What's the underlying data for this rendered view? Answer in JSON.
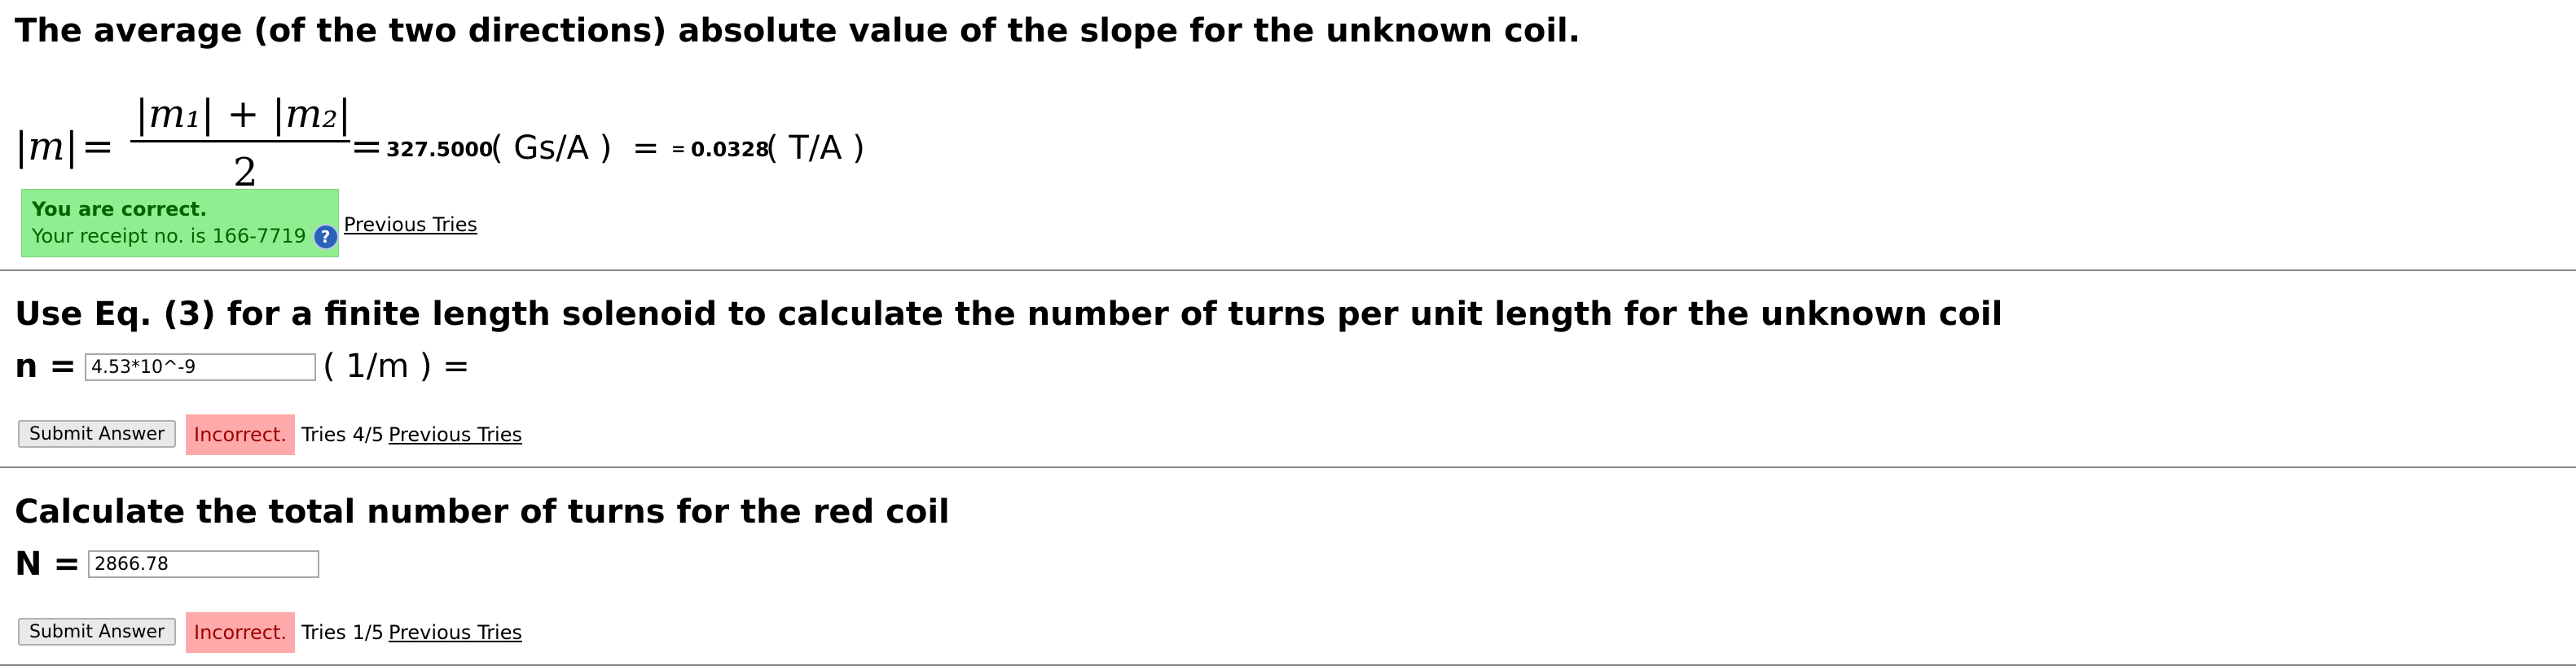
{
  "section1": {
    "heading": "The average (of the two directions) absolute value of the slope for the unknown coil.",
    "formula": {
      "lhs": "|m|",
      "equals": "=",
      "numerator": "|m₁| + |m₂|",
      "denominator": "2",
      "value_gs": "327.5000",
      "unit_gs": "( Gs/A )",
      "equals2": "=",
      "eq_small": "=",
      "value_t": "0.0328",
      "unit_t": "( T/A )"
    },
    "feedback": {
      "status": "You are correct.",
      "receipt": "Your receipt no. is 166-7719",
      "help_icon": "question-circle-icon"
    },
    "previous_tries": "Previous Tries"
  },
  "section2": {
    "heading": "Use Eq. (3) for a finite length solenoid to calculate the number of turns per unit length for the unknown coil",
    "label": "n =",
    "input_value": "4.53*10^-9",
    "unit": "( 1/m ) =",
    "submit": "Submit Answer",
    "status": "Incorrect.",
    "tries": "Tries 4/5",
    "previous_tries": "Previous Tries"
  },
  "section3": {
    "heading": "Calculate the total number of turns for the red coil",
    "label": "N =",
    "input_value": "2866.78",
    "submit": "Submit Answer",
    "status": "Incorrect.",
    "tries": "Tries 1/5",
    "previous_tries": "Previous Tries"
  },
  "colors": {
    "correct_bg": "#90ee90",
    "correct_text": "#006400",
    "incorrect_bg": "#ffaaaa",
    "incorrect_text": "#a00000"
  }
}
